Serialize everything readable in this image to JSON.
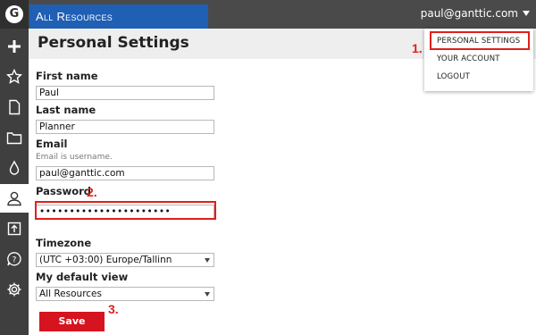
{
  "topbar": {
    "logo_letter": "G",
    "view_tab": "All Resources",
    "user_email": "paul@ganttic.com"
  },
  "sidebar": {
    "items": [
      {
        "icon": "plus-icon"
      },
      {
        "icon": "star-icon"
      },
      {
        "icon": "document-icon"
      },
      {
        "icon": "folder-icon"
      },
      {
        "icon": "drop-icon"
      },
      {
        "icon": "user-icon",
        "active": true
      },
      {
        "icon": "upload-icon"
      },
      {
        "icon": "help-icon"
      },
      {
        "icon": "gear-icon"
      }
    ]
  },
  "page": {
    "title": "Personal Settings"
  },
  "form": {
    "first_name_label": "First name",
    "first_name_value": "Paul",
    "last_name_label": "Last name",
    "last_name_value": "Planner",
    "email_label": "Email",
    "email_hint": "Email is username.",
    "email_value": "paul@ganttic.com",
    "password_label": "Password",
    "password_value": "••••••••••••••••••••••",
    "timezone_label": "Timezone",
    "timezone_value": "(UTC +03:00) Europe/Tallinn",
    "default_view_label": "My default view",
    "default_view_value": "All Resources",
    "save_label": "Save"
  },
  "dropdown": {
    "items": [
      "PERSONAL SETTINGS",
      "YOUR ACCOUNT",
      "LOGOUT"
    ]
  },
  "annotations": {
    "step1": "1.",
    "step2": "2.",
    "step3": "3."
  },
  "colors": {
    "topbar": "#4a4a4a",
    "sidebar": "#3f3f3f",
    "accent_blue": "#1f5fb4",
    "save_red": "#d51420",
    "annotation_red": "#e0201a"
  }
}
